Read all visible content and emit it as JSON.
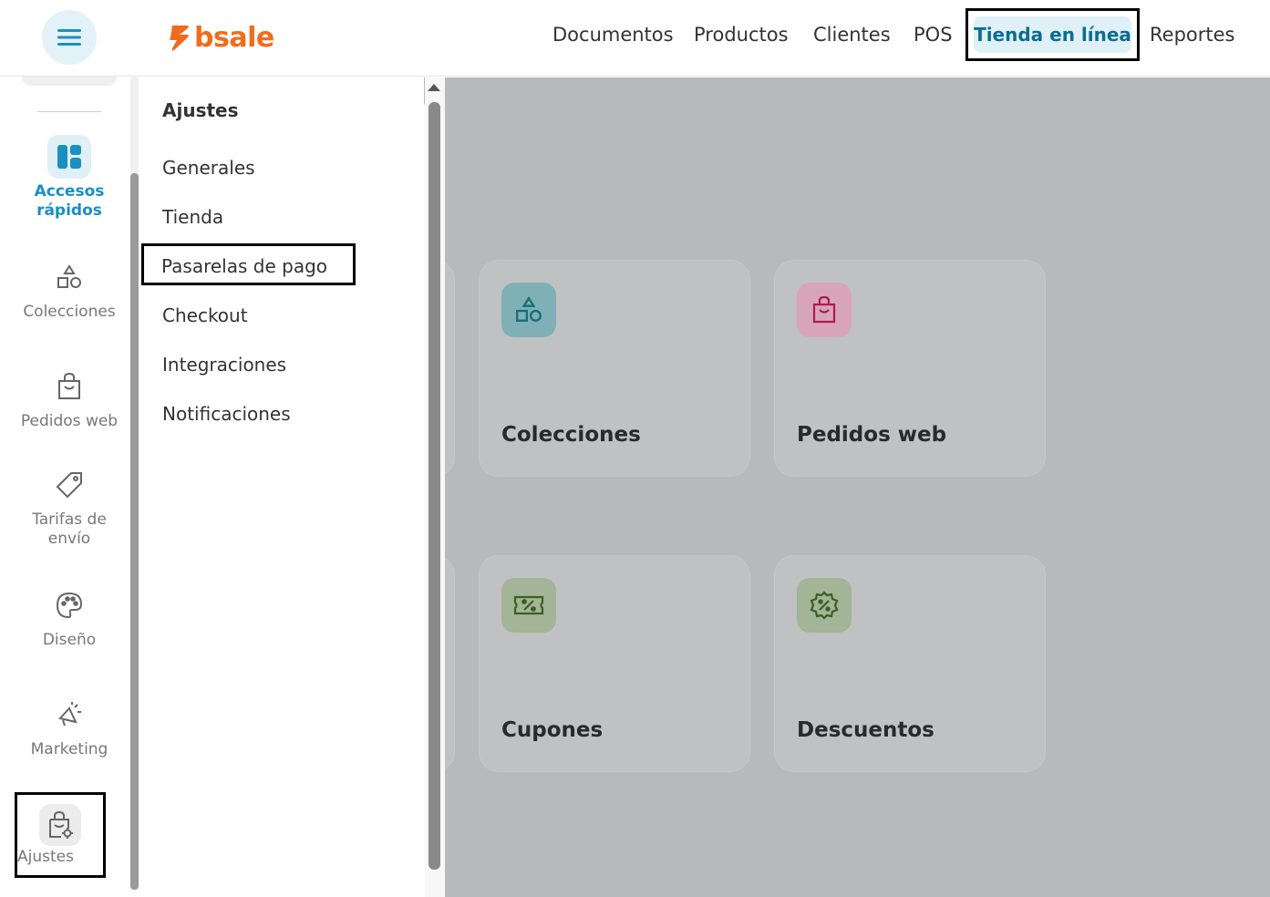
{
  "topbar": {
    "brand": "bsale",
    "nav": [
      {
        "label": "Documentos"
      },
      {
        "label": "Productos"
      },
      {
        "label": "Clientes"
      },
      {
        "label": "POS"
      },
      {
        "label": "Tienda en línea",
        "active": true
      },
      {
        "label": "Reportes"
      }
    ]
  },
  "rail": {
    "items": [
      {
        "label": "Accesos rápidos",
        "icon": "dashboard-icon",
        "active": true
      },
      {
        "label": "Colecciones",
        "icon": "shapes-icon"
      },
      {
        "label": "Pedidos web",
        "icon": "shopping-bag-icon"
      },
      {
        "label": "Tarifas de envío",
        "icon": "tag-icon"
      },
      {
        "label": "Diseño",
        "icon": "palette-icon"
      },
      {
        "label": "Marketing",
        "icon": "megaphone-icon"
      },
      {
        "label": "Ajustes",
        "icon": "bag-settings-icon"
      }
    ]
  },
  "submenu": {
    "title": "Ajustes",
    "items": [
      {
        "label": "Generales"
      },
      {
        "label": "Tienda"
      },
      {
        "label": "Pasarelas de pago",
        "highlighted": true
      },
      {
        "label": "Checkout"
      },
      {
        "label": "Integraciones"
      },
      {
        "label": "Notificaciones"
      }
    ]
  },
  "cards": [
    {
      "label": "Colecciones",
      "icon": "shapes-icon",
      "color": "#1a7f8e"
    },
    {
      "label": "Pedidos web",
      "icon": "shopping-bag-icon",
      "color": "#c2185b"
    },
    {
      "label": "Cupones",
      "icon": "coupon-icon",
      "color": "#3f6b1f"
    },
    {
      "label": "Descuentos",
      "icon": "discount-badge-icon",
      "color": "#3f6b1f"
    }
  ],
  "colors": {
    "accent": "#1a8fc2",
    "brand": "#f26b1d",
    "overlay": "#b8b9ba"
  }
}
